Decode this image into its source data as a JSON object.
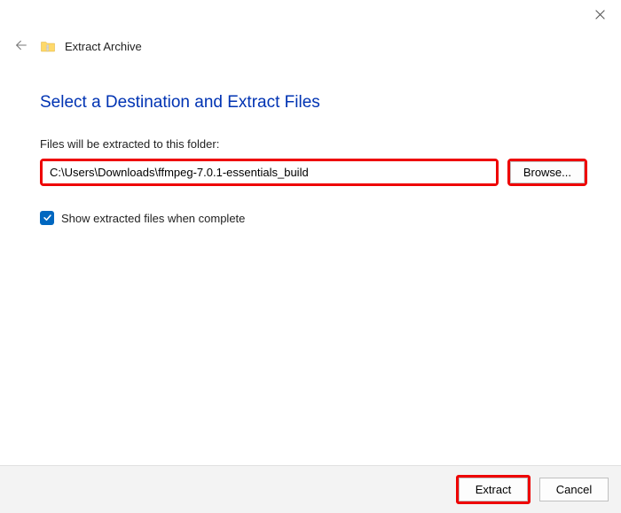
{
  "window": {
    "title": "Extract Archive"
  },
  "heading": "Select a Destination and Extract Files",
  "subtext": "Files will be extracted to this folder:",
  "path": "C:\\Users\\Downloads\\ffmpeg-7.0.1-essentials_build",
  "browse_label": "Browse...",
  "checkbox": {
    "checked": true,
    "label": "Show extracted files when complete"
  },
  "footer": {
    "extract_label": "Extract",
    "cancel_label": "Cancel"
  }
}
